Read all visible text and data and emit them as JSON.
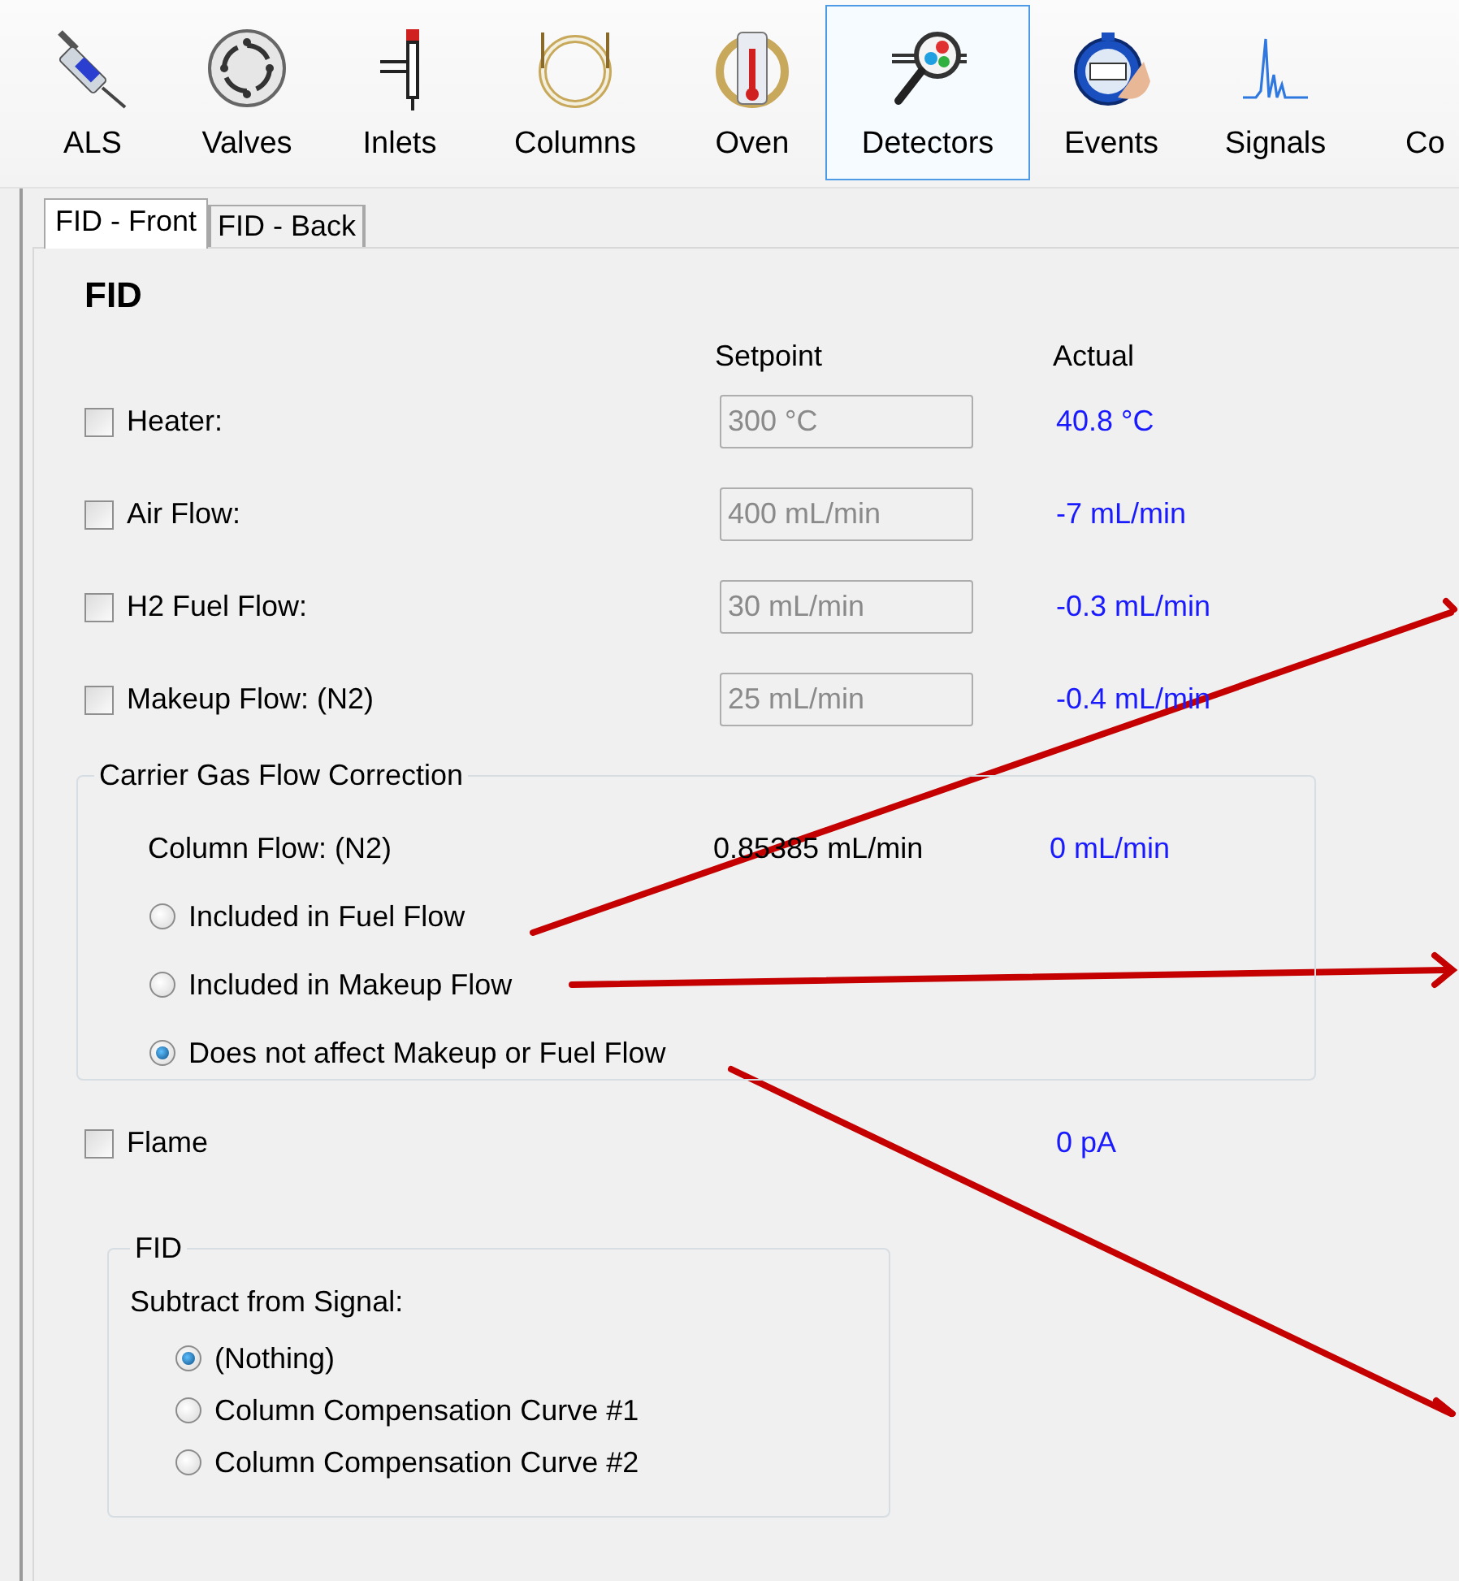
{
  "toolbar": {
    "items": [
      {
        "label": "ALS",
        "selected": false
      },
      {
        "label": "Valves",
        "selected": false
      },
      {
        "label": "Inlets",
        "selected": false
      },
      {
        "label": "Columns",
        "selected": false
      },
      {
        "label": "Oven",
        "selected": false
      },
      {
        "label": "Detectors",
        "selected": true
      },
      {
        "label": "Events",
        "selected": false
      },
      {
        "label": "Signals",
        "selected": false
      },
      {
        "label": "Co",
        "selected": false
      }
    ]
  },
  "tabs": [
    {
      "label": "FID - Front",
      "selected": true
    },
    {
      "label": "FID - Back",
      "selected": false
    }
  ],
  "panel": {
    "heading": "FID",
    "columns": {
      "setpoint": "Setpoint",
      "actual": "Actual"
    },
    "settings": [
      {
        "label": "Heater:",
        "checked": false,
        "setpoint": "300 °C",
        "disabled": true,
        "actual": "40.8 °C"
      },
      {
        "label": "Air Flow:",
        "checked": false,
        "setpoint": "400 mL/min",
        "disabled": true,
        "actual": "-7 mL/min"
      },
      {
        "label": "H2 Fuel Flow:",
        "checked": false,
        "setpoint": "30 mL/min",
        "disabled": true,
        "actual": "-0.3 mL/min"
      },
      {
        "label": "Makeup Flow: (N2)",
        "checked": false,
        "setpoint": "25 mL/min",
        "disabled": true,
        "actual": "-0.4 mL/min"
      }
    ],
    "carrier_group": {
      "title": "Carrier Gas Flow Correction",
      "column_flow": {
        "label": "Column Flow: (N2)",
        "setpoint": "0.85385 mL/min",
        "actual": "0 mL/min"
      },
      "options": [
        {
          "label": "Included in Fuel Flow",
          "selected": false
        },
        {
          "label": "Included in Makeup Flow",
          "selected": false
        },
        {
          "label": "Does not affect Makeup or Fuel Flow",
          "selected": true
        }
      ]
    },
    "flame": {
      "label": "Flame",
      "checked": false,
      "actual": "0 pA"
    },
    "fid_group": {
      "title": "FID",
      "prompt": "Subtract from Signal:",
      "options": [
        {
          "label": "(Nothing)",
          "selected": true
        },
        {
          "label": "Column Compensation Curve #1",
          "selected": false
        },
        {
          "label": "Column Compensation Curve #2",
          "selected": false
        }
      ]
    }
  }
}
